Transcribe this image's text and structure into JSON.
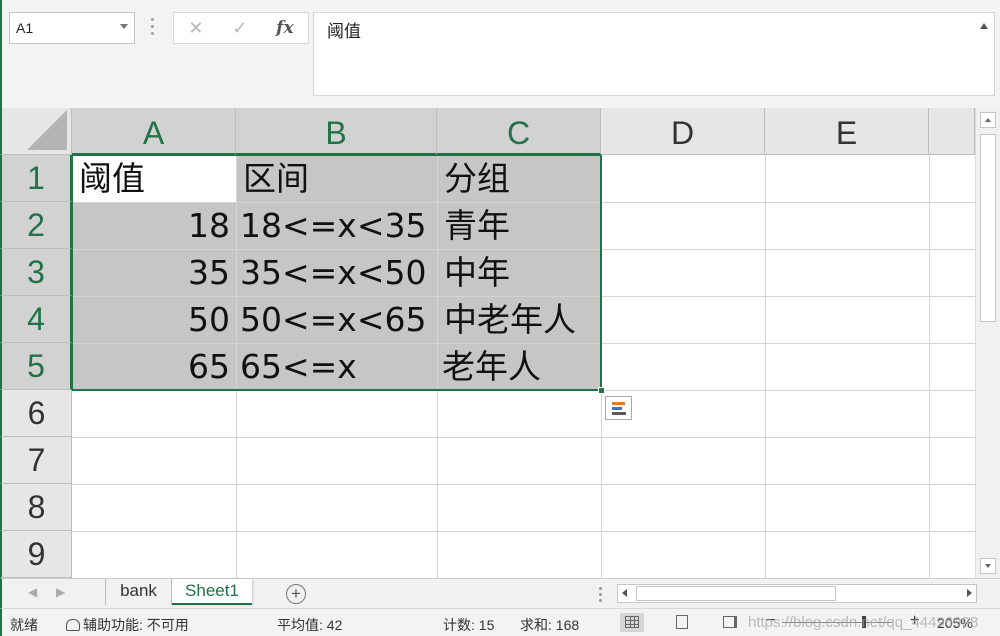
{
  "formula_bar": {
    "name_box": "A1",
    "cancel_icon": "✕",
    "enter_icon": "✓",
    "fx_label": "fx",
    "content": "阈值"
  },
  "columns": [
    "A",
    "B",
    "C",
    "D",
    "E"
  ],
  "rows": [
    "1",
    "2",
    "3",
    "4",
    "5",
    "6",
    "7",
    "8",
    "9"
  ],
  "cells": {
    "A1": "阈值",
    "B1": "区间",
    "C1": "分组",
    "A2": "18",
    "B2": "18<=x<35",
    "C2": "青年",
    "A3": "35",
    "B3": "35<=x<50",
    "C3": "中年",
    "A4": "50",
    "B4": "50<=x<65",
    "C4": "中老年人",
    "A5": "65",
    "B5": "65<=x",
    "C5": "老年人"
  },
  "selection": {
    "range": "A1:C5",
    "active_cell": "A1"
  },
  "sheets": {
    "tabs": [
      {
        "label": "bank",
        "active": false
      },
      {
        "label": "Sheet1",
        "active": true
      }
    ],
    "add_label": "+"
  },
  "status_bar": {
    "mode": "就绪",
    "accessibility": "辅助功能: 不可用",
    "average": "平均值: 42",
    "count": "计数: 15",
    "sum": "求和: 168",
    "zoom_minus": "−",
    "zoom_plus": "+",
    "zoom": "205%",
    "watermark": "https://blog.csdn.net/qq_44496998"
  },
  "colors": {
    "accent": "#217346",
    "selection": "#c6c6c6"
  },
  "icons": [
    "cancel-icon",
    "enter-icon",
    "function-icon",
    "quick-analysis-icon",
    "accessibility-icon",
    "normal-view-icon",
    "page-layout-icon",
    "page-break-icon"
  ]
}
